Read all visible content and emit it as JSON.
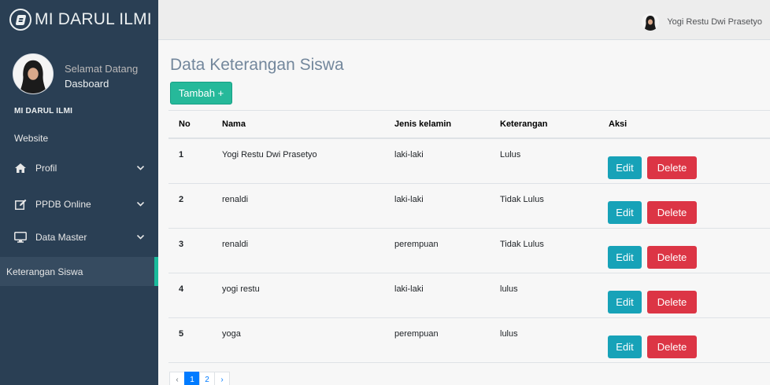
{
  "brand": {
    "title": "MI DARUL ILMI"
  },
  "profile": {
    "welcome": "Selamat Datang",
    "name": "Dasboard"
  },
  "sidebar": {
    "section_title": "MI DARUL ILMI",
    "items": [
      {
        "label": "Website",
        "icon": "none"
      },
      {
        "label": "Profil",
        "icon": "home-icon",
        "chevron": "❯"
      },
      {
        "label": "PPDB Online",
        "icon": "edit-icon",
        "chevron": "❯"
      },
      {
        "label": "Data Master",
        "icon": "desktop-icon",
        "chevron": "❯"
      },
      {
        "label": "Keterangan Siswa",
        "icon": "none",
        "active": true
      }
    ]
  },
  "topbar": {
    "user_name": "Yogi Restu Dwi Prasetyo"
  },
  "main": {
    "title": "Data Keterangan Siswa",
    "add_button": "Tambah +",
    "table": {
      "headers": [
        "No",
        "Nama",
        "Jenis kelamin",
        "Keterangan",
        "Aksi"
      ],
      "rows": [
        {
          "no": "1",
          "nama": "Yogi Restu Dwi Prasetyo",
          "jk": "laki-laki",
          "ket": "Lulus"
        },
        {
          "no": "2",
          "nama": "renaldi",
          "jk": "laki-laki",
          "ket": "Tidak Lulus"
        },
        {
          "no": "3",
          "nama": "renaldi",
          "jk": "perempuan",
          "ket": "Tidak Lulus"
        },
        {
          "no": "4",
          "nama": "yogi restu",
          "jk": "laki-laki",
          "ket": "lulus"
        },
        {
          "no": "5",
          "nama": "yoga",
          "jk": "perempuan",
          "ket": "lulus"
        }
      ],
      "edit_label": "Edit",
      "delete_label": "Delete"
    },
    "pagination": {
      "prev": "‹",
      "pages": [
        "1",
        "2"
      ],
      "next": "›",
      "current": "1"
    }
  },
  "colors": {
    "sidebar_bg": "#2a3f54",
    "accent": "#1ABB9C",
    "add_button": "#26B99A",
    "edit_button": "#17A2B8",
    "delete_button": "#DC3545",
    "page_active": "#007bff"
  }
}
